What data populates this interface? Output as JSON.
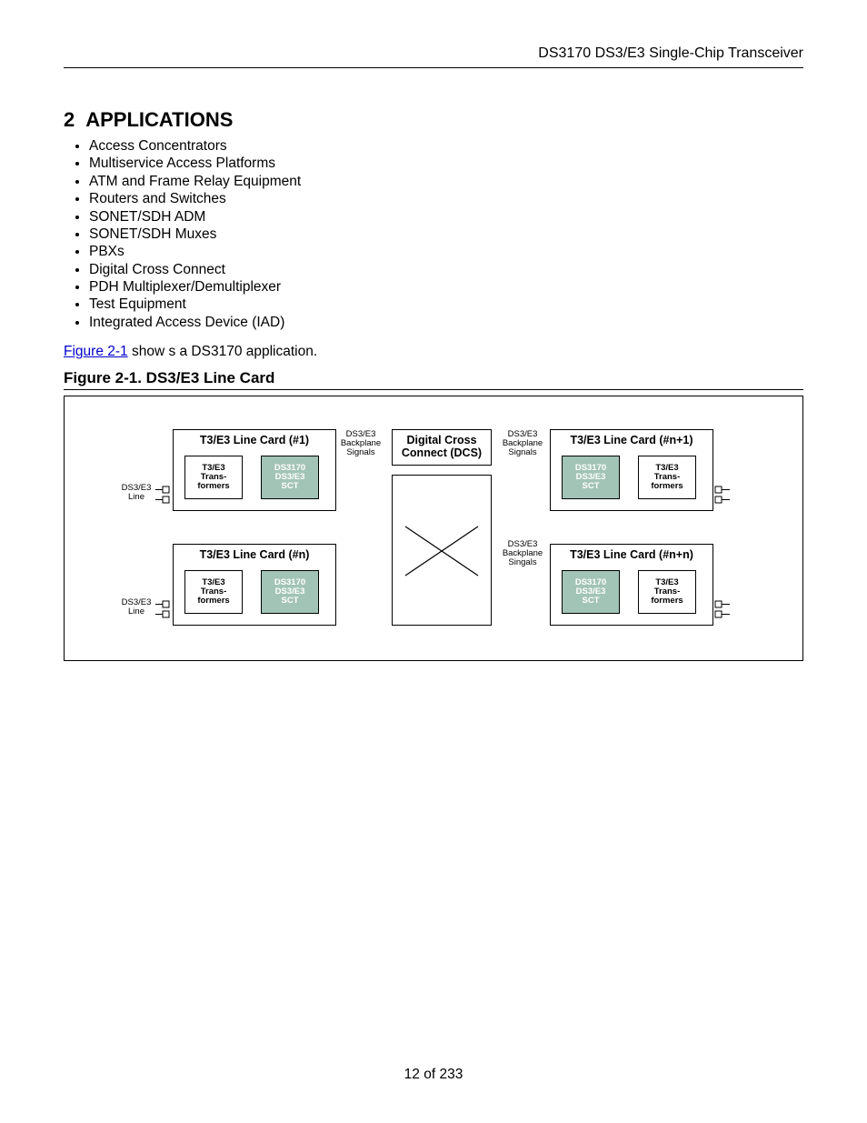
{
  "header": {
    "title": "DS3170 DS3/E3 Single-Chip Transceiver"
  },
  "section": {
    "number": "2",
    "title": "APPLICATIONS"
  },
  "applications": [
    "Access Concentrators",
    "Multiservice Access Platforms",
    "ATM and Frame Relay Equipment",
    "Routers and Switches",
    "SONET/SDH ADM",
    "SONET/SDH Muxes",
    "PBXs",
    "Digital Cross Connect",
    "PDH Multiplexer/Demultiplexer",
    "Test Equipment",
    "Integrated Access Device (IAD)"
  ],
  "reference": {
    "link_text": "Figure 2-1",
    "tail_text": " show s a DS3170 application."
  },
  "figure": {
    "caption": "Figure 2-1. DS3/E3 Line Card"
  },
  "diagram": {
    "ds3e3_line_1": "DS3/E3",
    "ds3e3_line_2": "Line",
    "backplane_1": "DS3/E3",
    "backplane_2": "Backplane",
    "backplane_3": "Signals",
    "backplane_singals_1": "DS3/E3",
    "backplane_singals_2": "Backplane",
    "backplane_singals_3": "Singals",
    "card1": {
      "title": "T3/E3 Line Card (#1)",
      "transformers_1": "T3/E3",
      "transformers_2": "Trans-",
      "transformers_3": "formers",
      "chip_1": "DS3170",
      "chip_2": "DS3/E3",
      "chip_3": "SCT"
    },
    "card_n": {
      "title": "T3/E3 Line Card (#n)",
      "transformers_1": "T3/E3",
      "transformers_2": "Trans-",
      "transformers_3": "formers",
      "chip_1": "DS3170",
      "chip_2": "DS3/E3",
      "chip_3": "SCT"
    },
    "card_np1": {
      "title": "T3/E3 Line Card (#n+1)",
      "transformers_1": "T3/E3",
      "transformers_2": "Trans-",
      "transformers_3": "formers",
      "chip_1": "DS3170",
      "chip_2": "DS3/E3",
      "chip_3": "SCT"
    },
    "card_npn": {
      "title": "T3/E3 Line Card (#n+n)",
      "transformers_1": "T3/E3",
      "transformers_2": "Trans-",
      "transformers_3": "formers",
      "chip_1": "DS3170",
      "chip_2": "DS3/E3",
      "chip_3": "SCT"
    },
    "dcs_1": "Digital Cross",
    "dcs_2": "Connect (DCS)"
  },
  "page_number": "12 of 233"
}
